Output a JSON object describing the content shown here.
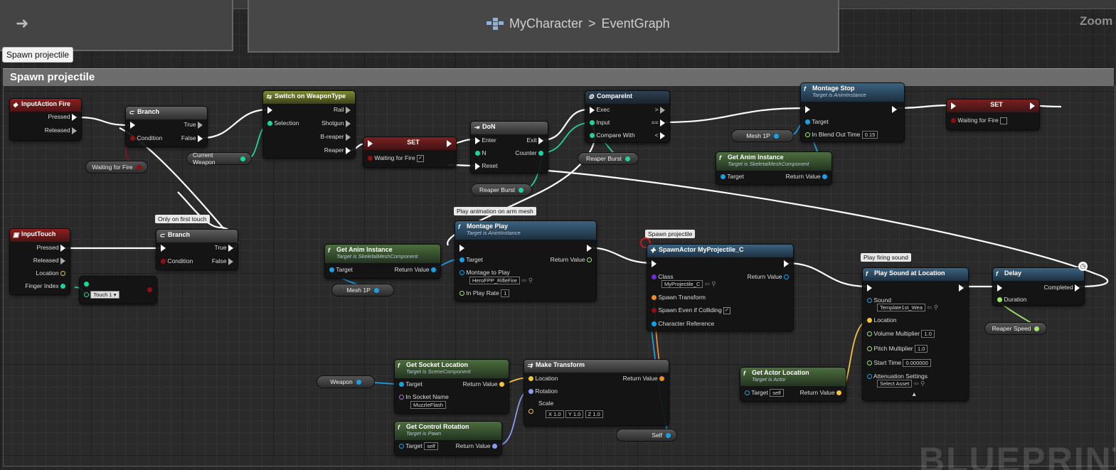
{
  "breadcrumb": {
    "asset": "MyCharacter",
    "separator": ">",
    "graph": "EventGraph"
  },
  "zoom_label": "Zoom",
  "tooltip": "Spawn projectile",
  "comment_title": "Spawn projectile",
  "watermark": "BLUEPRINT",
  "colors": {
    "exec": "#ffffff",
    "bool": "#8c1010",
    "object": "#1aa0e0",
    "float": "#9ee66c",
    "int": "#1fd3a0",
    "vector": "#f5c33b",
    "transform": "#f08a2a",
    "class": "#6b2fd0",
    "struct": "#7b8ff0"
  },
  "nodes": {
    "input_fire": {
      "title": "InputAction Fire",
      "pressed": "Pressed",
      "released": "Released"
    },
    "branch1": {
      "title": "Branch",
      "condition": "Condition",
      "true": "True",
      "false": "False"
    },
    "switch": {
      "title": "Switch on WeaponType",
      "selection": "Selection",
      "outs": [
        "Rail",
        "Shotgun",
        "B-reaper",
        "Reaper"
      ]
    },
    "set1": {
      "title": "SET",
      "var": "Waiting for Fire"
    },
    "don": {
      "title": "DoN",
      "enter": "Enter",
      "n": "N",
      "reset": "Reset",
      "exit": "Exit",
      "counter": "Counter"
    },
    "compare": {
      "title": "CompareInt",
      "exec": "Exec",
      "input": "Input",
      "compare_with": "Compare With",
      "outs": [
        ">",
        "==",
        "<"
      ]
    },
    "montage_stop": {
      "title": "Montage Stop",
      "subtitle": "Target is AnimInstance",
      "target": "Target",
      "blend": "In Blend Out Time",
      "blend_value": "0.15"
    },
    "set2": {
      "title": "SET",
      "var": "Waiting for Fire"
    },
    "get_anim1": {
      "title": "Get Anim Instance",
      "subtitle": "Target is SkeletalMeshComponent",
      "target": "Target",
      "ret": "Return Value"
    },
    "input_touch": {
      "title": "InputTouch",
      "outs": [
        "Pressed",
        "Released",
        "Location",
        "Finger Index"
      ]
    },
    "branch2": {
      "title": "Branch",
      "condition": "Condition",
      "true": "True",
      "false": "False"
    },
    "equal_touch": {
      "value": "Touch 1"
    },
    "get_anim2": {
      "title": "Get Anim Instance",
      "subtitle": "Target is SkeletalMeshComponent",
      "target": "Target",
      "ret": "Return Value"
    },
    "montage_play": {
      "title": "Montage Play",
      "subtitle": "Target is AnimInstance",
      "target": "Target",
      "montage": "Montage to Play",
      "montage_value": "HeroFPP_RifleFire",
      "rate": "In Play Rate",
      "rate_value": "1",
      "ret": "Return Value"
    },
    "spawn_actor": {
      "title": "SpawnActor MyProjectile_C",
      "class": "Class",
      "class_value": "MyProjectile_C",
      "spawn_transform": "Spawn Transform",
      "spawn_even": "Spawn Even if Colliding",
      "char_ref": "Character Reference",
      "ret": "Return Value"
    },
    "play_sound": {
      "title": "Play Sound at Location",
      "sound": "Sound",
      "sound_value": "Template1st_Wea",
      "location": "Location",
      "volume": "Volume Multiplier",
      "volume_value": "1.0",
      "pitch": "Pitch Multiplier",
      "pitch_value": "1.0",
      "start": "Start Time",
      "start_value": "0.000000",
      "atten": "Attenuation Settings",
      "atten_value": "Select Asset"
    },
    "delay": {
      "title": "Delay",
      "completed": "Completed",
      "duration": "Duration"
    },
    "get_socket": {
      "title": "Get Socket Location",
      "subtitle": "Target is SceneComponent",
      "target": "Target",
      "socket": "In Socket Name",
      "socket_value": "MuzzleFlash",
      "ret": "Return Value"
    },
    "make_transform": {
      "title": "Make Transform",
      "location": "Location",
      "rotation": "Rotation",
      "scale": "Scale",
      "sx": "X 1.0",
      "sy": "Y 1.0",
      "sz": "Z 1.0",
      "ret": "Return Value"
    },
    "get_control": {
      "title": "Get Control Rotation",
      "subtitle": "Target is Pawn",
      "target": "Target",
      "target_value": "self",
      "ret": "Return Value"
    },
    "get_actor_loc": {
      "title": "Get Actor Location",
      "subtitle": "Target is Actor",
      "target": "Target",
      "target_value": "self",
      "ret": "Return Value"
    }
  },
  "variables": {
    "waiting_for_fire": "Waiting for Fire",
    "current_weapon": "Current Weapon",
    "reaper_burst_1": "Reaper Burst",
    "reaper_burst_2": "Reaper Burst",
    "mesh_1p_1": "Mesh 1P",
    "mesh_1p_2": "Mesh 1P",
    "weapon": "Weapon",
    "self": "Self",
    "reaper_speed": "Reaper Speed"
  },
  "annotations": {
    "only_first_touch": "Only on first touch",
    "play_anim": "Play animation on arm mesh",
    "spawn_projectile": "Spawn projectile",
    "play_sound": "Play firing sound"
  }
}
